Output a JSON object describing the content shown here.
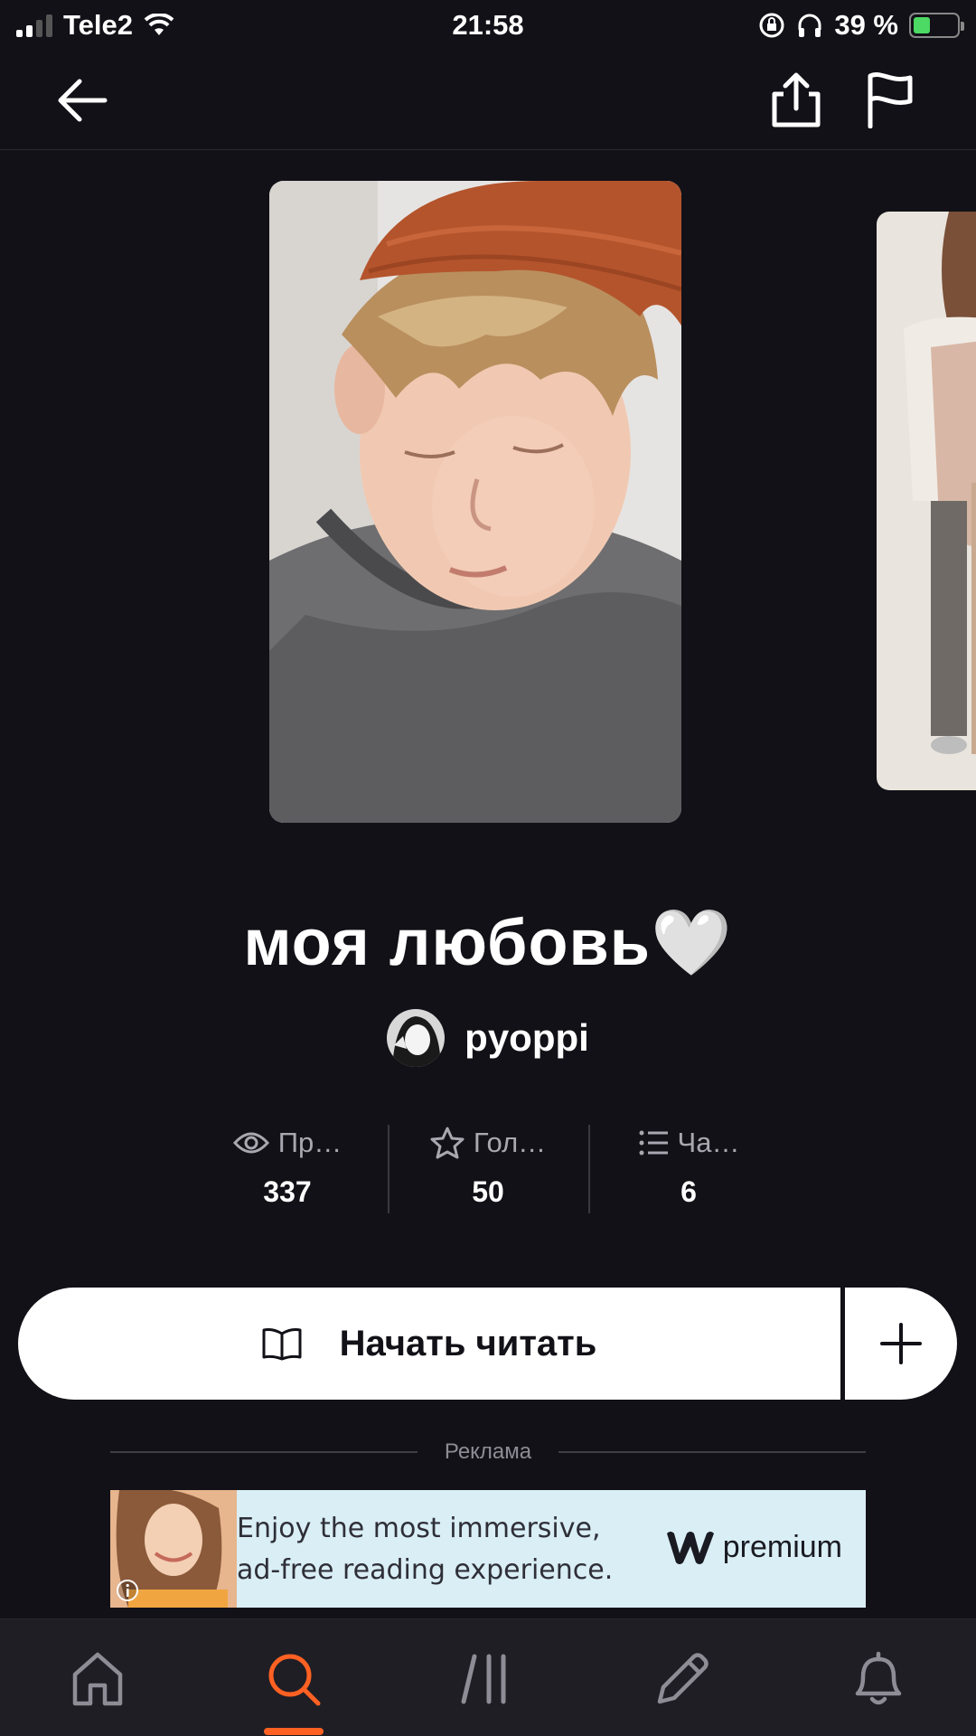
{
  "status_bar": {
    "carrier": "Tele2",
    "time": "21:58",
    "battery_percent": "39 %",
    "battery_level": 0.39
  },
  "story": {
    "title": "моя любовь🤍",
    "author": "pyoppi"
  },
  "stats": [
    {
      "label": "Пр…",
      "value": "337",
      "icon": "eye-icon"
    },
    {
      "label": "Гол…",
      "value": "50",
      "icon": "star-icon"
    },
    {
      "label": "Ча…",
      "value": "6",
      "icon": "list-icon"
    }
  ],
  "actions": {
    "read_label": "Начать читать"
  },
  "ad": {
    "label": "Реклама",
    "line1": "Enjoy the most immersive,",
    "line2": "ad-free reading experience.",
    "brand": "premium"
  },
  "colors": {
    "background": "#121117",
    "accent": "#ff6122",
    "battery": "#4cd964"
  },
  "bottom_nav": {
    "active": "search",
    "tabs": [
      "home-icon",
      "search-icon",
      "library-icon",
      "write-icon",
      "bell-icon"
    ]
  }
}
